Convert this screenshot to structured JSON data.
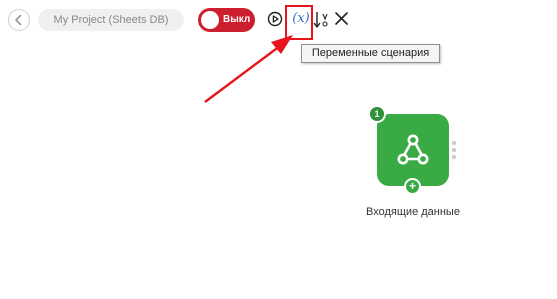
{
  "toolbar": {
    "back_icon": "chevron-left-icon",
    "project_name": "My Project (Sheets DB)",
    "toggle_label": "Выкл",
    "toggle_color": "#cc1f2d",
    "run_icon": "play-circle-icon",
    "variables_icon": "variable-x-icon",
    "variables_symbol": "(x)",
    "sort_icon": "sort-az-icon",
    "close_icon": "close-icon"
  },
  "tooltip": {
    "text": "Переменные сценария"
  },
  "annotation": {
    "highlight_color": "#e8141b"
  },
  "module": {
    "badge": "1",
    "icon": "webhook-icon",
    "color": "#3aab44",
    "label": "Входящие данные",
    "add_symbol": "+"
  }
}
